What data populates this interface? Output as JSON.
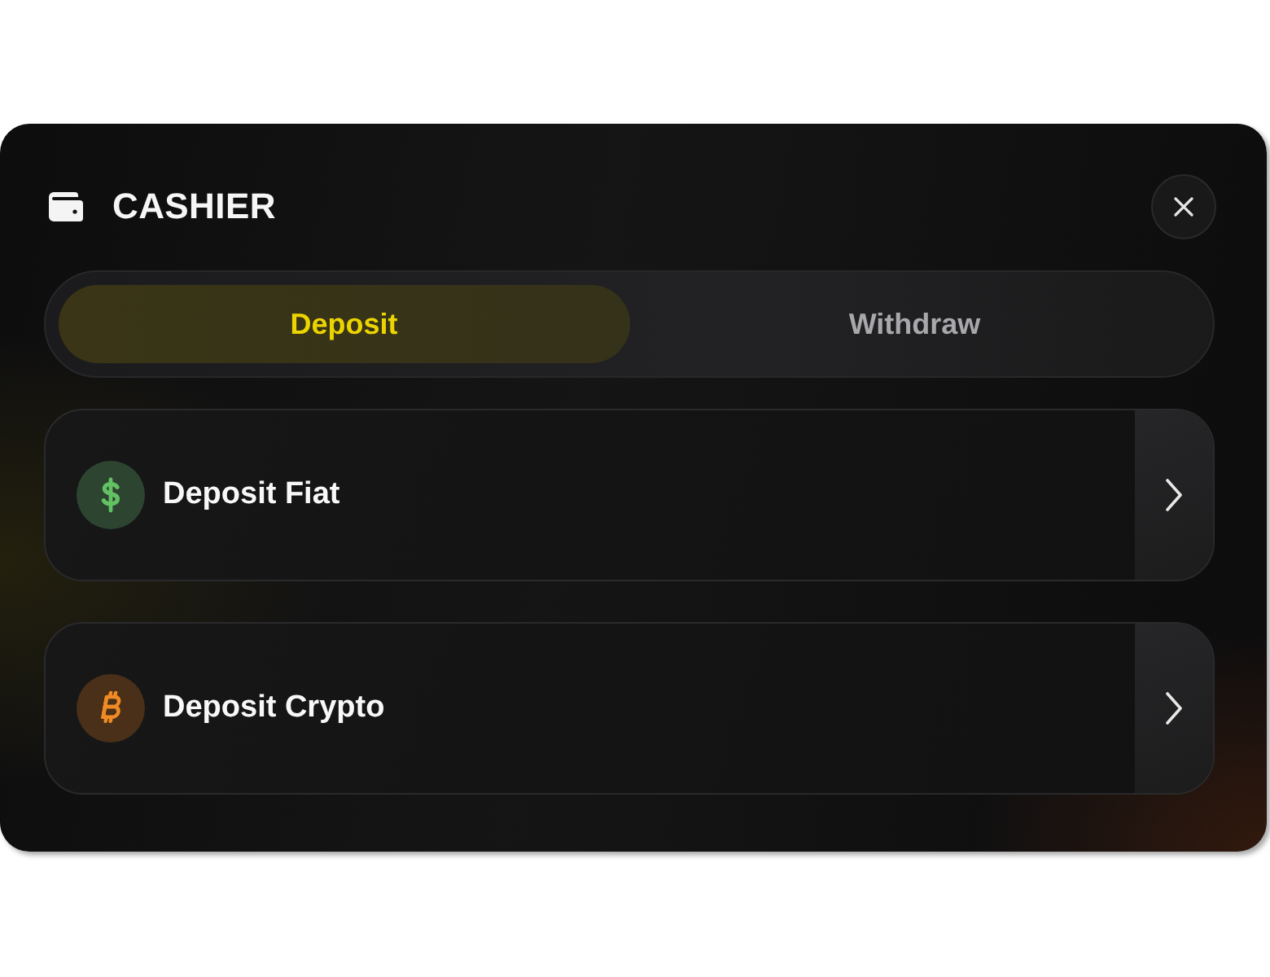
{
  "header": {
    "title": "CASHIER"
  },
  "tabs": [
    {
      "label": "Deposit",
      "selected": true
    },
    {
      "label": "Withdraw",
      "selected": false
    }
  ],
  "options": [
    {
      "kind": "fiat",
      "label": "Deposit Fiat"
    },
    {
      "kind": "crypto",
      "label": "Deposit Crypto"
    }
  ]
}
